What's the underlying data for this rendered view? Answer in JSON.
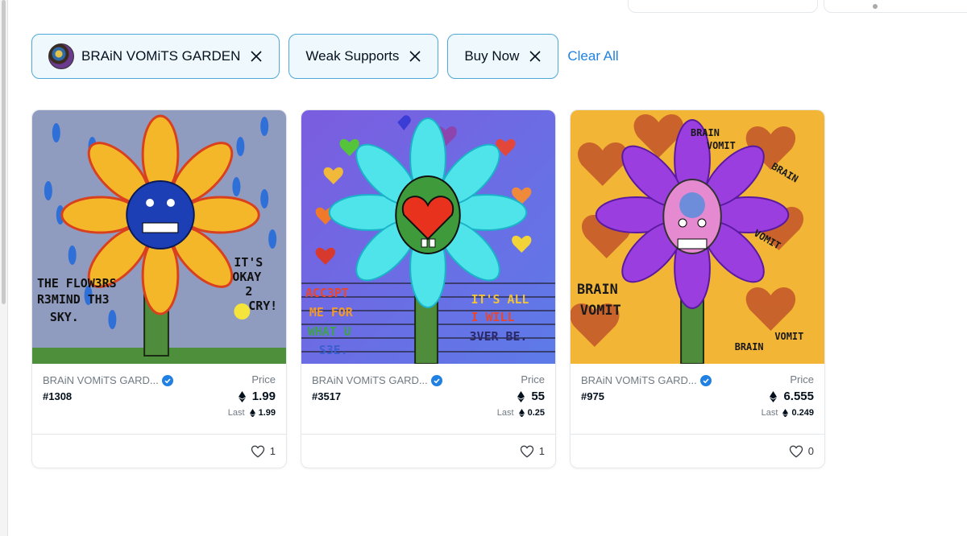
{
  "filters": {
    "chips": [
      {
        "label": "BRAiN VOMiTS GARDEN"
      },
      {
        "label": "Weak Supports"
      },
      {
        "label": "Buy Now"
      }
    ],
    "clear_all": "Clear All"
  },
  "cards": [
    {
      "collection": "BRAiN VOMiTS GARD...",
      "token": "#1308",
      "price_label": "Price",
      "price": "1.99",
      "last_label": "Last",
      "last": "1.99",
      "likes": "1",
      "art_text": [
        "THE FLOW3RS",
        "R3MIND TH3",
        "SKY.",
        "IT'S",
        "OKAY",
        "2",
        "CRY!"
      ]
    },
    {
      "collection": "BRAiN VOMiTS GARD...",
      "token": "#3517",
      "price_label": "Price",
      "price": "55",
      "last_label": "Last",
      "last": "0.25",
      "likes": "1",
      "art_text": [
        "ACC3PT",
        "ME FOR",
        "WHAT U",
        "S3E.",
        "IT'S ALL",
        "I WILL",
        "3VER BE."
      ]
    },
    {
      "collection": "BRAiN VOMiTS GARD...",
      "token": "#975",
      "price_label": "Price",
      "price": "6.555",
      "last_label": "Last",
      "last": "0.249",
      "likes": "0",
      "art_text": [
        "BRAIN",
        "VOMIT",
        "BRAIN",
        "VOMIT",
        "BRAIN",
        "VOMIT",
        "BRAIN",
        "VOMIT"
      ]
    }
  ],
  "colors": {
    "accent": "#2081e2",
    "chip_border": "#4ea8d8",
    "chip_bg": "#eef8fd"
  },
  "icons": {
    "close": "close-icon",
    "verified": "verified-badge-icon",
    "eth": "ethereum-icon",
    "like": "heart-icon"
  }
}
